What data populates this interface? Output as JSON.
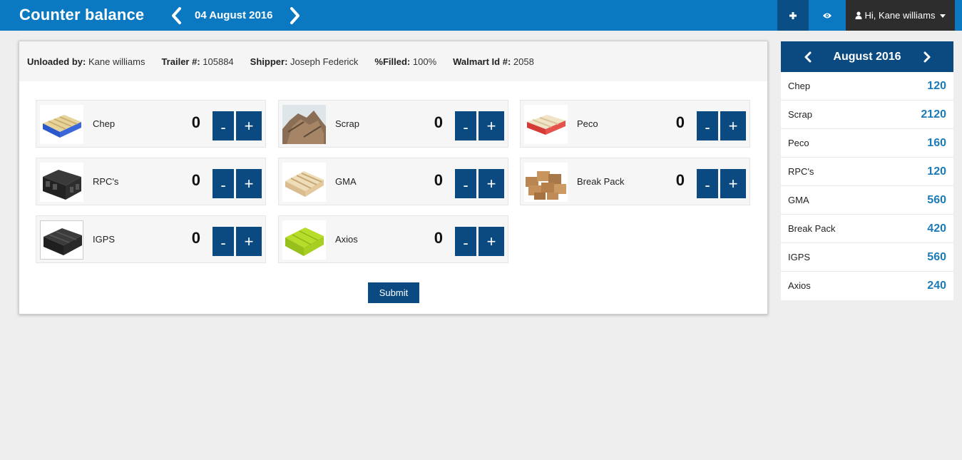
{
  "header": {
    "title": "Counter balance",
    "date": "04 August 2016",
    "user_greeting": "Hi, Kane williams",
    "add_icon": "plus-icon",
    "view_icon": "eye-icon",
    "user_icon": "user-icon",
    "prev_icon": "chevron-left-icon",
    "next_icon": "chevron-right-icon"
  },
  "colors": {
    "topbar": "#0a79c2",
    "primary_dark": "#0b4a80",
    "user_bg": "#2d2d2d",
    "value_blue": "#1b7ab8",
    "page_bg": "#eeeeee"
  },
  "info": {
    "unloaded_by_label": "Unloaded by:",
    "unloaded_by_value": "Kane williams",
    "trailer_label": "Trailer #:",
    "trailer_value": "105884",
    "shipper_label": "Shipper:",
    "shipper_value": "Joseph Federick",
    "filled_label": "%Filled:",
    "filled_value": "100%",
    "walmart_label": "Walmart Id #:",
    "walmart_value": "2058"
  },
  "items": [
    {
      "name": "Chep",
      "count": "0",
      "minus": "-",
      "plus": "+"
    },
    {
      "name": "Scrap",
      "count": "0",
      "minus": "-",
      "plus": "+"
    },
    {
      "name": "Peco",
      "count": "0",
      "minus": "-",
      "plus": "+"
    },
    {
      "name": "RPC's",
      "count": "0",
      "minus": "-",
      "plus": "+"
    },
    {
      "name": "GMA",
      "count": "0",
      "minus": "-",
      "plus": "+"
    },
    {
      "name": "Break Pack",
      "count": "0",
      "minus": "-",
      "plus": "+"
    },
    {
      "name": "IGPS",
      "count": "0",
      "minus": "-",
      "plus": "+"
    },
    {
      "name": "Axios",
      "count": "0",
      "minus": "-",
      "plus": "+"
    }
  ],
  "submit_label": "Submit",
  "side": {
    "month": "August 2016",
    "rows": [
      {
        "name": "Chep",
        "value": "120"
      },
      {
        "name": "Scrap",
        "value": "2120"
      },
      {
        "name": "Peco",
        "value": "160"
      },
      {
        "name": "RPC's",
        "value": "120"
      },
      {
        "name": "GMA",
        "value": "560"
      },
      {
        "name": "Break Pack",
        "value": "420"
      },
      {
        "name": "IGPS",
        "value": "560"
      },
      {
        "name": "Axios",
        "value": "240"
      }
    ]
  }
}
